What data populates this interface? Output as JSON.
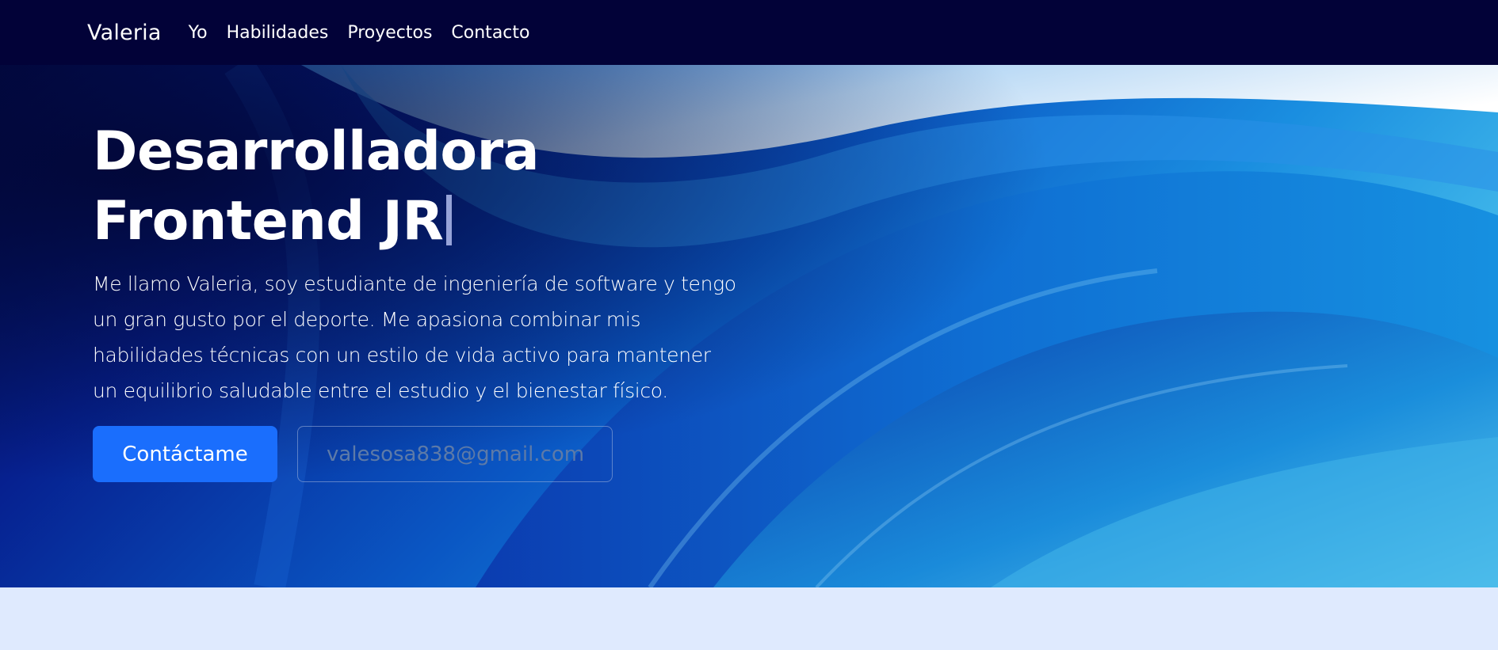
{
  "navbar": {
    "brand": "Valeria",
    "links": [
      "Yo",
      "Habilidades",
      "Proyectos",
      "Contacto"
    ],
    "background": "#020238"
  },
  "hero": {
    "title_line1": "Desarrolladora",
    "title_line2": "Frontend JR",
    "description": "Me llamo Valeria, soy estudiante de ingeniería de software y tengo un gran gusto por el deporte. Me apasiona combinar mis habilidades técnicas con un estilo de vida activo para mantener un equilibrio saludable entre el estudio y el bienestar físico.",
    "cta_label": "Contáctame",
    "email_placeholder": "valesosa838@gmail.com",
    "accent_color": "#1a6efd"
  },
  "page": {
    "section_background": "#dfeafe"
  }
}
